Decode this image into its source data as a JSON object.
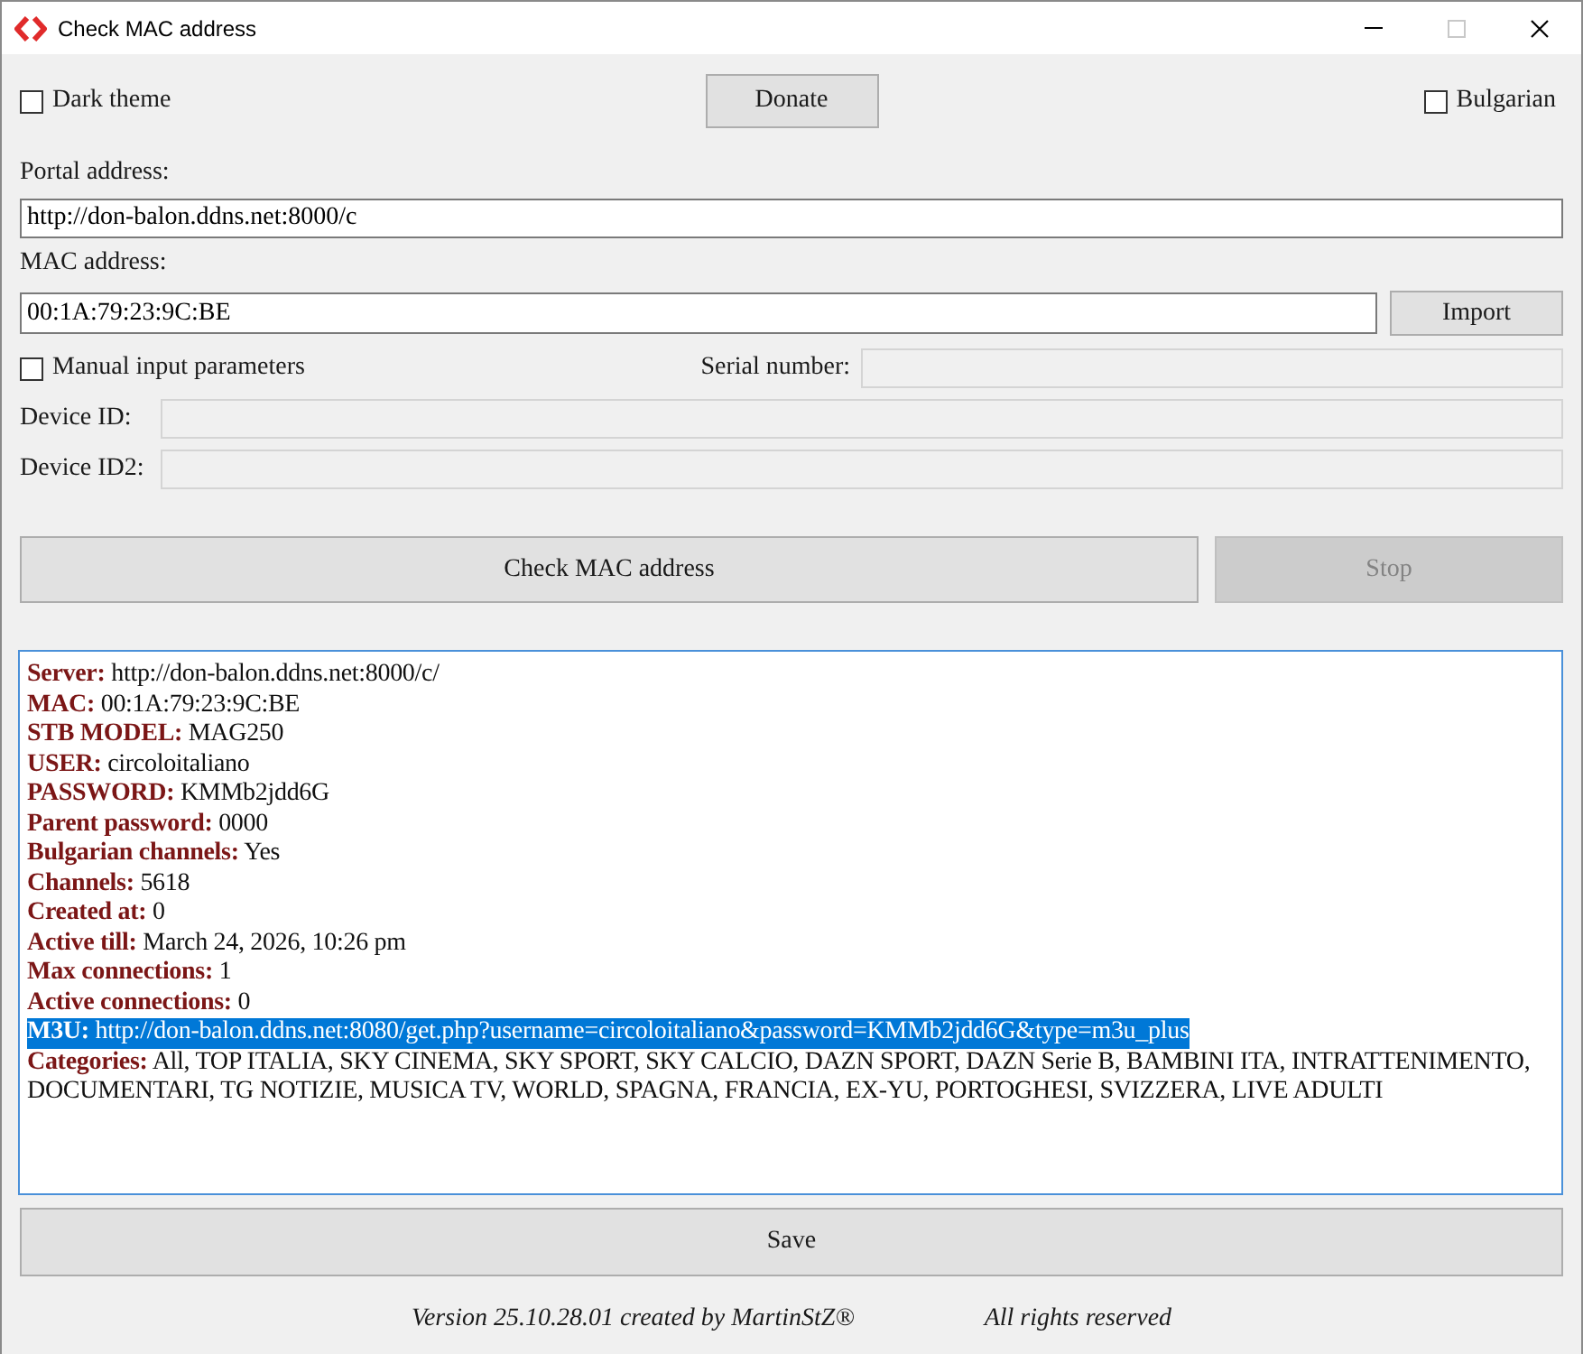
{
  "window": {
    "title": "Check MAC address",
    "controls": [
      {
        "kind": "minimize",
        "disabled": false
      },
      {
        "kind": "maximize",
        "disabled": true
      },
      {
        "kind": "close",
        "disabled": false
      }
    ]
  },
  "top_bar": {
    "dark_theme": {
      "label": "Dark theme",
      "checked": false
    },
    "donate_button": "Donate",
    "bulgarian": {
      "label": "Bulgarian",
      "checked": false
    }
  },
  "portal": {
    "label": "Portal address:",
    "value": "http://don-balon.ddns.net:8000/c",
    "disabled": false
  },
  "mac": {
    "label": "MAC address:",
    "value": "00:1A:79:23:9C:BE",
    "disabled": false,
    "import_button": "Import"
  },
  "manual": {
    "label": "Manual input parameters",
    "checked": false
  },
  "serial": {
    "label": "Serial number:",
    "disabled": true
  },
  "device_id": {
    "label": "Device ID:",
    "disabled": true
  },
  "device_id2": {
    "label": "Device ID2:",
    "disabled": true
  },
  "actions": [
    {
      "label": "Check MAC address",
      "disabled": false
    },
    {
      "label": "Stop",
      "disabled": true
    }
  ],
  "output": {
    "focused": true,
    "lines": [
      {
        "text": "**Server:** http://don-balon.ddns.net:8000/c/",
        "selected": false
      },
      {
        "text": "**MAC:** 00:1A:79:23:9C:BE",
        "selected": false
      },
      {
        "text": "**STB MODEL:** MAG250",
        "selected": false
      },
      {
        "text": "**USER:** circoloitaliano",
        "selected": false
      },
      {
        "text": "**PASSWORD:** KMMb2jdd6G",
        "selected": false
      },
      {
        "text": "**Parent password:** 0000",
        "selected": false
      },
      {
        "text": "**Bulgarian channels:** Yes",
        "selected": false
      },
      {
        "text": "**Channels:** 5618",
        "selected": false
      },
      {
        "text": "**Created at:** 0",
        "selected": false
      },
      {
        "text": "**Active till:** March 24, 2026, 10:26 pm",
        "selected": false
      },
      {
        "text": "**Max connections:** 1",
        "selected": false
      },
      {
        "text": "**Active connections:** 0",
        "selected": false
      },
      {
        "text": "**M3U:** http://don-balon.ddns.net:8080/get.php?username=circoloitaliano&password=KMMb2jdd6G&type=m3u_plus",
        "selected": true
      },
      {
        "text": "**Categories:** All, TOP ITALIA, SKY CINEMA, SKY SPORT, SKY CALCIO, DAZN SPORT, DAZN Serie B, BAMBINI ITA, INTRATTENIMENTO, DOCUMENTARI, TG NOTIZIE, MUSICA TV, WORLD, SPAGNA, FRANCIA, EX-YU, PORTOGHESI, SVIZZERA, LIVE ADULTI",
        "selected": false
      }
    ]
  },
  "save_button": "Save",
  "footer": {
    "version": "Version 25.10.28.01 created by MartinStZ®",
    "rights": "All rights reserved"
  }
}
